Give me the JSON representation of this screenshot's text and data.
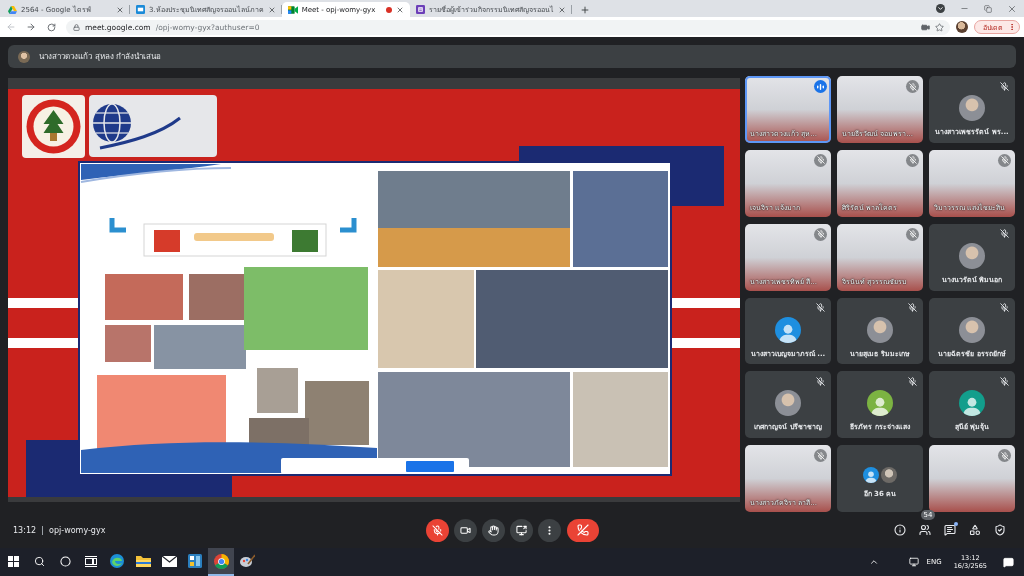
{
  "browser": {
    "tabs": [
      {
        "kind": "triangle",
        "title": "2564 - Google ไดรฟ์",
        "selected": false,
        "recording": false
      },
      {
        "kind": "square",
        "title": "3.ห้องประชุมนิเทศสัญจรออนไลน์ภาค",
        "selected": false,
        "recording": false
      },
      {
        "kind": "camera",
        "title": "Meet - opj-womy-gyx",
        "selected": true,
        "recording": true
      },
      {
        "kind": "form",
        "title": "รายชื่อผู้เข้าร่วมกิจกรรมนิเทศสัญจรออนไ",
        "selected": false,
        "recording": false
      }
    ],
    "back_disabled": true,
    "address": {
      "host": "meet.google.com",
      "path": "/opj-womy-gyx?authuser=0"
    },
    "update_button": "อัปเดต"
  },
  "meet": {
    "presenter_banner": "นางสาวดวงแก้ว สุหลง กำลังนำเสนอ",
    "participants": [
      {
        "kind": "video",
        "name": "นางสาวดวงแก้ว สุห...",
        "muted": false,
        "speaking": true
      },
      {
        "kind": "video",
        "name": "นายธีรวัฒน์ จอมพรา...",
        "muted": true,
        "speaking": false
      },
      {
        "kind": "photo-avatar",
        "name": "นางสาวเพชรรัตน์ พร...",
        "muted": true,
        "speaking": false
      },
      {
        "kind": "video",
        "name": "เจนจิรา แจ้งมาก",
        "muted": true,
        "speaking": false
      },
      {
        "kind": "video",
        "name": "ศิริรัตน์ พาลโคตร",
        "muted": true,
        "speaking": false
      },
      {
        "kind": "video",
        "name": "วิมาวรรณ แสงไชยะสิน",
        "muted": true,
        "speaking": false
      },
      {
        "kind": "video",
        "name": "นางสาวเพชรทิพย์ สี...",
        "muted": true,
        "speaking": false
      },
      {
        "kind": "video",
        "name": "จิรนันท์ สุวรรณชัยรบ",
        "muted": true,
        "speaking": false
      },
      {
        "kind": "photo-avatar",
        "name": "นางนวรัตน์ พิมนอก",
        "muted": true,
        "speaking": false
      },
      {
        "kind": "default-avatar",
        "name": "นางสาวเบญจมาภรณ์ ...",
        "muted": true,
        "speaking": false,
        "color": "#1e8fe0"
      },
      {
        "kind": "photo-avatar",
        "name": "นายสุเมธ ริมมะเกษ",
        "muted": true,
        "speaking": false
      },
      {
        "kind": "photo-avatar",
        "name": "นายฉัตรชัย อรรถยักษ์",
        "muted": true,
        "speaking": false
      },
      {
        "kind": "photo-avatar",
        "name": "เกศกาญจน์ ปรีชาชาญ",
        "muted": true,
        "speaking": false
      },
      {
        "kind": "default-avatar",
        "name": "ธีรภัทร กระจ่างแสง",
        "muted": true,
        "speaking": false,
        "color": "#7cb342"
      },
      {
        "kind": "default-avatar",
        "name": "สุนีย์ พุ่มจุ้น",
        "muted": true,
        "speaking": false,
        "color": "#129e8c"
      },
      {
        "kind": "video",
        "name": "นางสาวภัคจิรา ลาสี...",
        "muted": true,
        "speaking": false
      },
      {
        "kind": "overflow",
        "name": "อีก 36 คน",
        "muted": false,
        "speaking": false
      },
      {
        "kind": "video",
        "muted": true,
        "speaking": false
      }
    ],
    "meeting_time": "13:12",
    "meeting_code": "opj-womy-gyx",
    "mic_muted": true,
    "camera_off": false,
    "people_count": "54",
    "chat_unread": true
  },
  "taskbar": {
    "apps": [
      {
        "kind": "swirl",
        "active": false
      },
      {
        "kind": "folder",
        "active": false
      },
      {
        "kind": "mail",
        "active": false
      },
      {
        "kind": "tiles",
        "active": false
      },
      {
        "kind": "ring",
        "active": true
      },
      {
        "kind": "brush",
        "active": false
      }
    ],
    "language": "ENG",
    "time": "13:12",
    "date": "16/3/2565"
  }
}
